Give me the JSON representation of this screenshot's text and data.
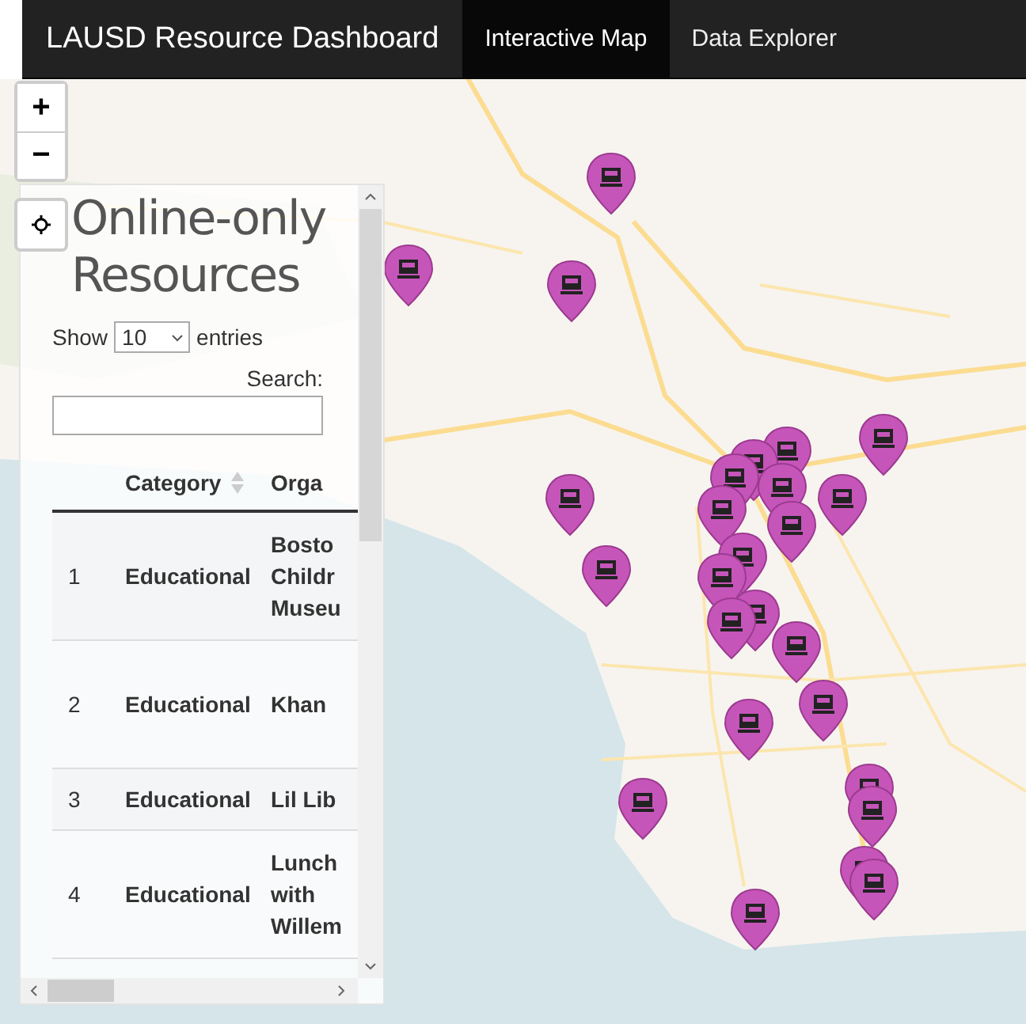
{
  "navbar": {
    "brand": "LAUSD Resource Dashboard",
    "tabs": [
      {
        "label": "Interactive Map",
        "selected": true
      },
      {
        "label": "Data Explorer",
        "selected": false
      }
    ]
  },
  "map_controls": {
    "zoom_in": "+",
    "zoom_out": "−"
  },
  "panel": {
    "title": "Online-only Resources",
    "length": {
      "before": "Show",
      "value": "10",
      "after": "entries"
    },
    "search": {
      "label": "Search:"
    },
    "table": {
      "columns": [
        "Category",
        "Orga"
      ],
      "rows": [
        {
          "index": "1",
          "category": "Educational",
          "organization": [
            "Bosto",
            "Childr",
            "Museu"
          ]
        },
        {
          "index": "2",
          "category": "Educational",
          "organization": [
            "Khan"
          ]
        },
        {
          "index": "3",
          "category": "Educational",
          "organization": [
            "Lil Lib"
          ]
        },
        {
          "index": "4",
          "category": "Educational",
          "organization": [
            "Lunch",
            "with",
            "Willem"
          ]
        }
      ]
    }
  }
}
